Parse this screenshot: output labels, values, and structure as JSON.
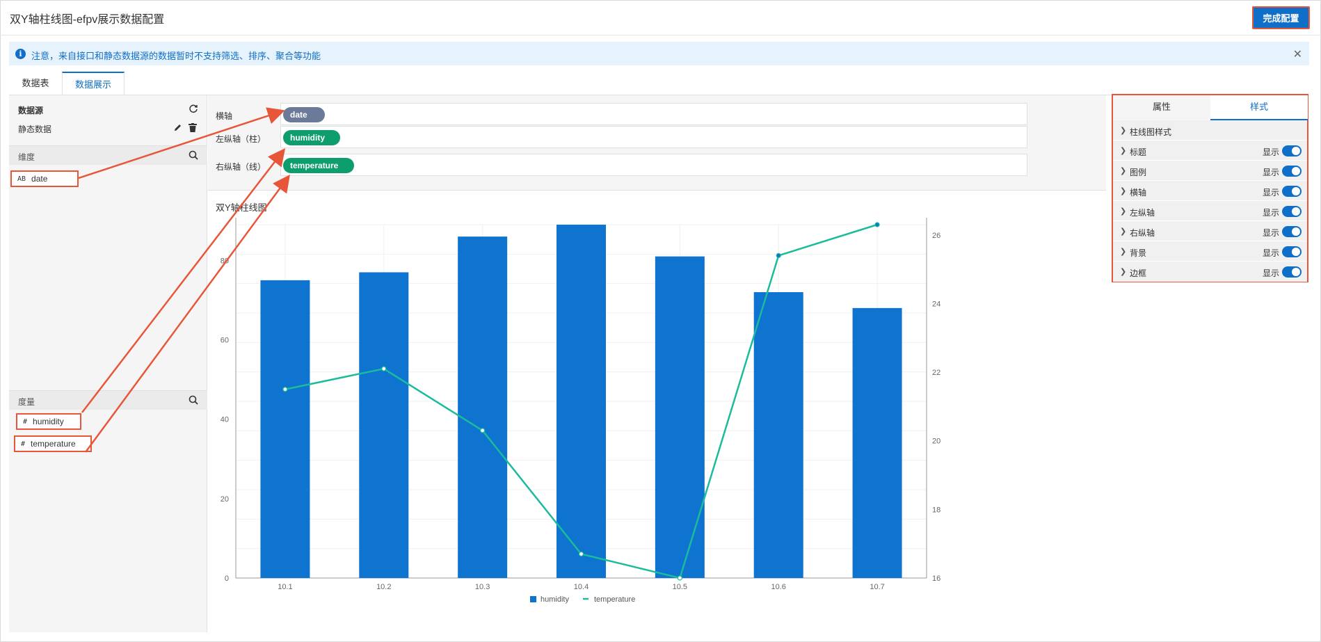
{
  "header": {
    "title": "双Y轴柱线图-efpv展示数据配置",
    "finish_label": "完成配置"
  },
  "notice": {
    "icon": "info-icon",
    "text": "注意，来自接口和静态数据源的数据暂时不支持筛选、排序、聚合等功能",
    "close": "✕"
  },
  "tabs": [
    {
      "label": "数据表"
    },
    {
      "label": "数据展示",
      "active": true
    }
  ],
  "left": {
    "datasource_label": "数据源",
    "datasource_value": "静态数据",
    "dimension_label": "维度",
    "measure_label": "度量",
    "dimensions": [
      {
        "type": "AB",
        "name": "date"
      }
    ],
    "measures": [
      {
        "type": "#",
        "name": "humidity"
      },
      {
        "type": "#",
        "name": "temperature"
      }
    ]
  },
  "axes": [
    {
      "label": "横轴",
      "field": "date"
    },
    {
      "label": "左纵轴（柱）",
      "field": "humidity"
    },
    {
      "label": "右纵轴（线）",
      "field": "temperature"
    }
  ],
  "colors": {
    "accent": "#0f6fc8",
    "highlight": "#e8563a",
    "bar": "#0f74cf",
    "line": "#1abc9c",
    "dim_pill": "#6b7a99",
    "measure_pill": "#0e9e6e"
  },
  "chart_data": {
    "type": "bar",
    "title": "双Y轴柱线图",
    "categories": [
      "10.1",
      "10.2",
      "10.3",
      "10.4",
      "10.5",
      "10.6",
      "10.7"
    ],
    "series": [
      {
        "name": "humidity",
        "type": "bar",
        "axis": "left",
        "values": [
          75,
          77,
          86,
          89,
          81,
          72,
          68
        ]
      },
      {
        "name": "temperature",
        "type": "line",
        "axis": "right",
        "values": [
          21.5,
          22.1,
          20.3,
          16.7,
          16.0,
          25.4,
          26.3
        ]
      }
    ],
    "left_ticks": [
      "0",
      "20",
      "40",
      "60",
      "80"
    ],
    "right_ticks": [
      "16",
      "18",
      "20",
      "22",
      "24",
      "26"
    ],
    "ylim_left": [
      0,
      89
    ],
    "ylim_right": [
      16,
      26.3
    ],
    "grid": true,
    "legend": "bottom-center"
  },
  "right": {
    "tabs": [
      {
        "label": "属性"
      },
      {
        "label": "样式",
        "active": true
      }
    ],
    "items": [
      {
        "label": "柱线图样式"
      },
      {
        "label": "标题",
        "show": "显示",
        "on": true
      },
      {
        "label": "图例",
        "show": "显示",
        "on": true
      },
      {
        "label": "横轴",
        "show": "显示",
        "on": true
      },
      {
        "label": "左纵轴",
        "show": "显示",
        "on": true
      },
      {
        "label": "右纵轴",
        "show": "显示",
        "on": true
      },
      {
        "label": "背景",
        "show": "显示",
        "on": true
      },
      {
        "label": "边框",
        "show": "显示",
        "on": true
      }
    ]
  }
}
